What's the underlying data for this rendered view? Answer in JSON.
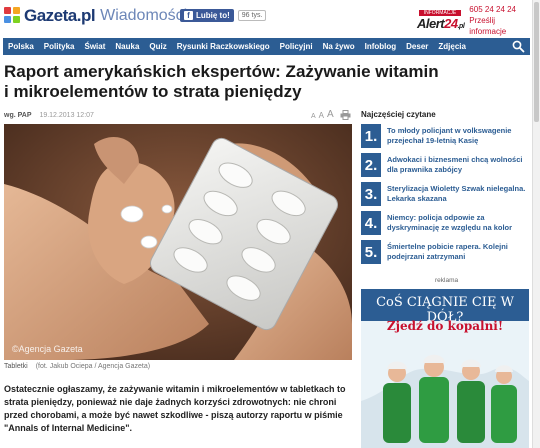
{
  "header": {
    "logo": "Gazeta.pl",
    "section": "Wiadomości",
    "facebook_like": "Lubię to!",
    "facebook_count": "96 tys.",
    "alert_top": "INFORMACJE",
    "alert_brand_a": "Alert",
    "alert_brand_b": "24",
    "alert_brand_c": ".pl",
    "alert_phone": "605 24 24 24",
    "alert_link": "Prześlij informacje"
  },
  "nav": {
    "items": [
      "Polska",
      "Polityka",
      "Świat",
      "Nauka",
      "Quiz",
      "Rysunki Raczkowskiego",
      "Policyjni",
      "Na żywo",
      "Infoblog",
      "Deser",
      "Zdjęcia"
    ]
  },
  "article": {
    "title": "Raport amerykańskich ekspertów: Zażywanie witamin i mikroelementów to strata pieniędzy",
    "author": "wg. PAP",
    "date": "19.12.2013 12:07",
    "font_small": "A",
    "font_medium": "A",
    "font_large": "A",
    "watermark": "©Agencja Gazeta",
    "caption_title": "Tabletki",
    "caption_credit": "(fot. Jakub Ociepa / Agencja Gazeta)",
    "lead": "Ostatecznie ogłaszamy, że zażywanie witamin i mikroelementów w tabletkach to strata pieniędzy, ponieważ nie daje żadnych korzyści zdrowotnych: nie chroni przed chorobami, a może być nawet szkodliwe - piszą autorzy raportu w piśmie \"Annals of Internal Medicine\"."
  },
  "sidebar": {
    "title": "Najczęściej czytane",
    "items": [
      {
        "num": "1.",
        "text": "To młody policjant w volkswagenie przejechał 19-letnią Kasię"
      },
      {
        "num": "2.",
        "text": "Adwokaci i biznesmeni chcą wolności dla prawnika zabójcy"
      },
      {
        "num": "3.",
        "text": "Sterylizacja Wioletty Szwak nielegalna. Lekarka skazana"
      },
      {
        "num": "4.",
        "text": "Niemcy: policja odpowie za dyskryminację ze względu na kolor"
      },
      {
        "num": "5.",
        "text": "Śmiertelne pobicie rapera. Kolejni podejrzani zatrzymani"
      }
    ],
    "ad_label": "reklama",
    "ad_title": "CoŚ CIĄGNIE CIĘ W DÓŁ?",
    "ad_subtitle": "Zjedź do kopalni!"
  },
  "colors": {
    "brand": "#1d3a73",
    "nav": "#2c5d93",
    "alert_red": "#c8102e"
  },
  "icons": {
    "search": "search-icon",
    "print": "print-icon",
    "facebook": "facebook-icon"
  }
}
